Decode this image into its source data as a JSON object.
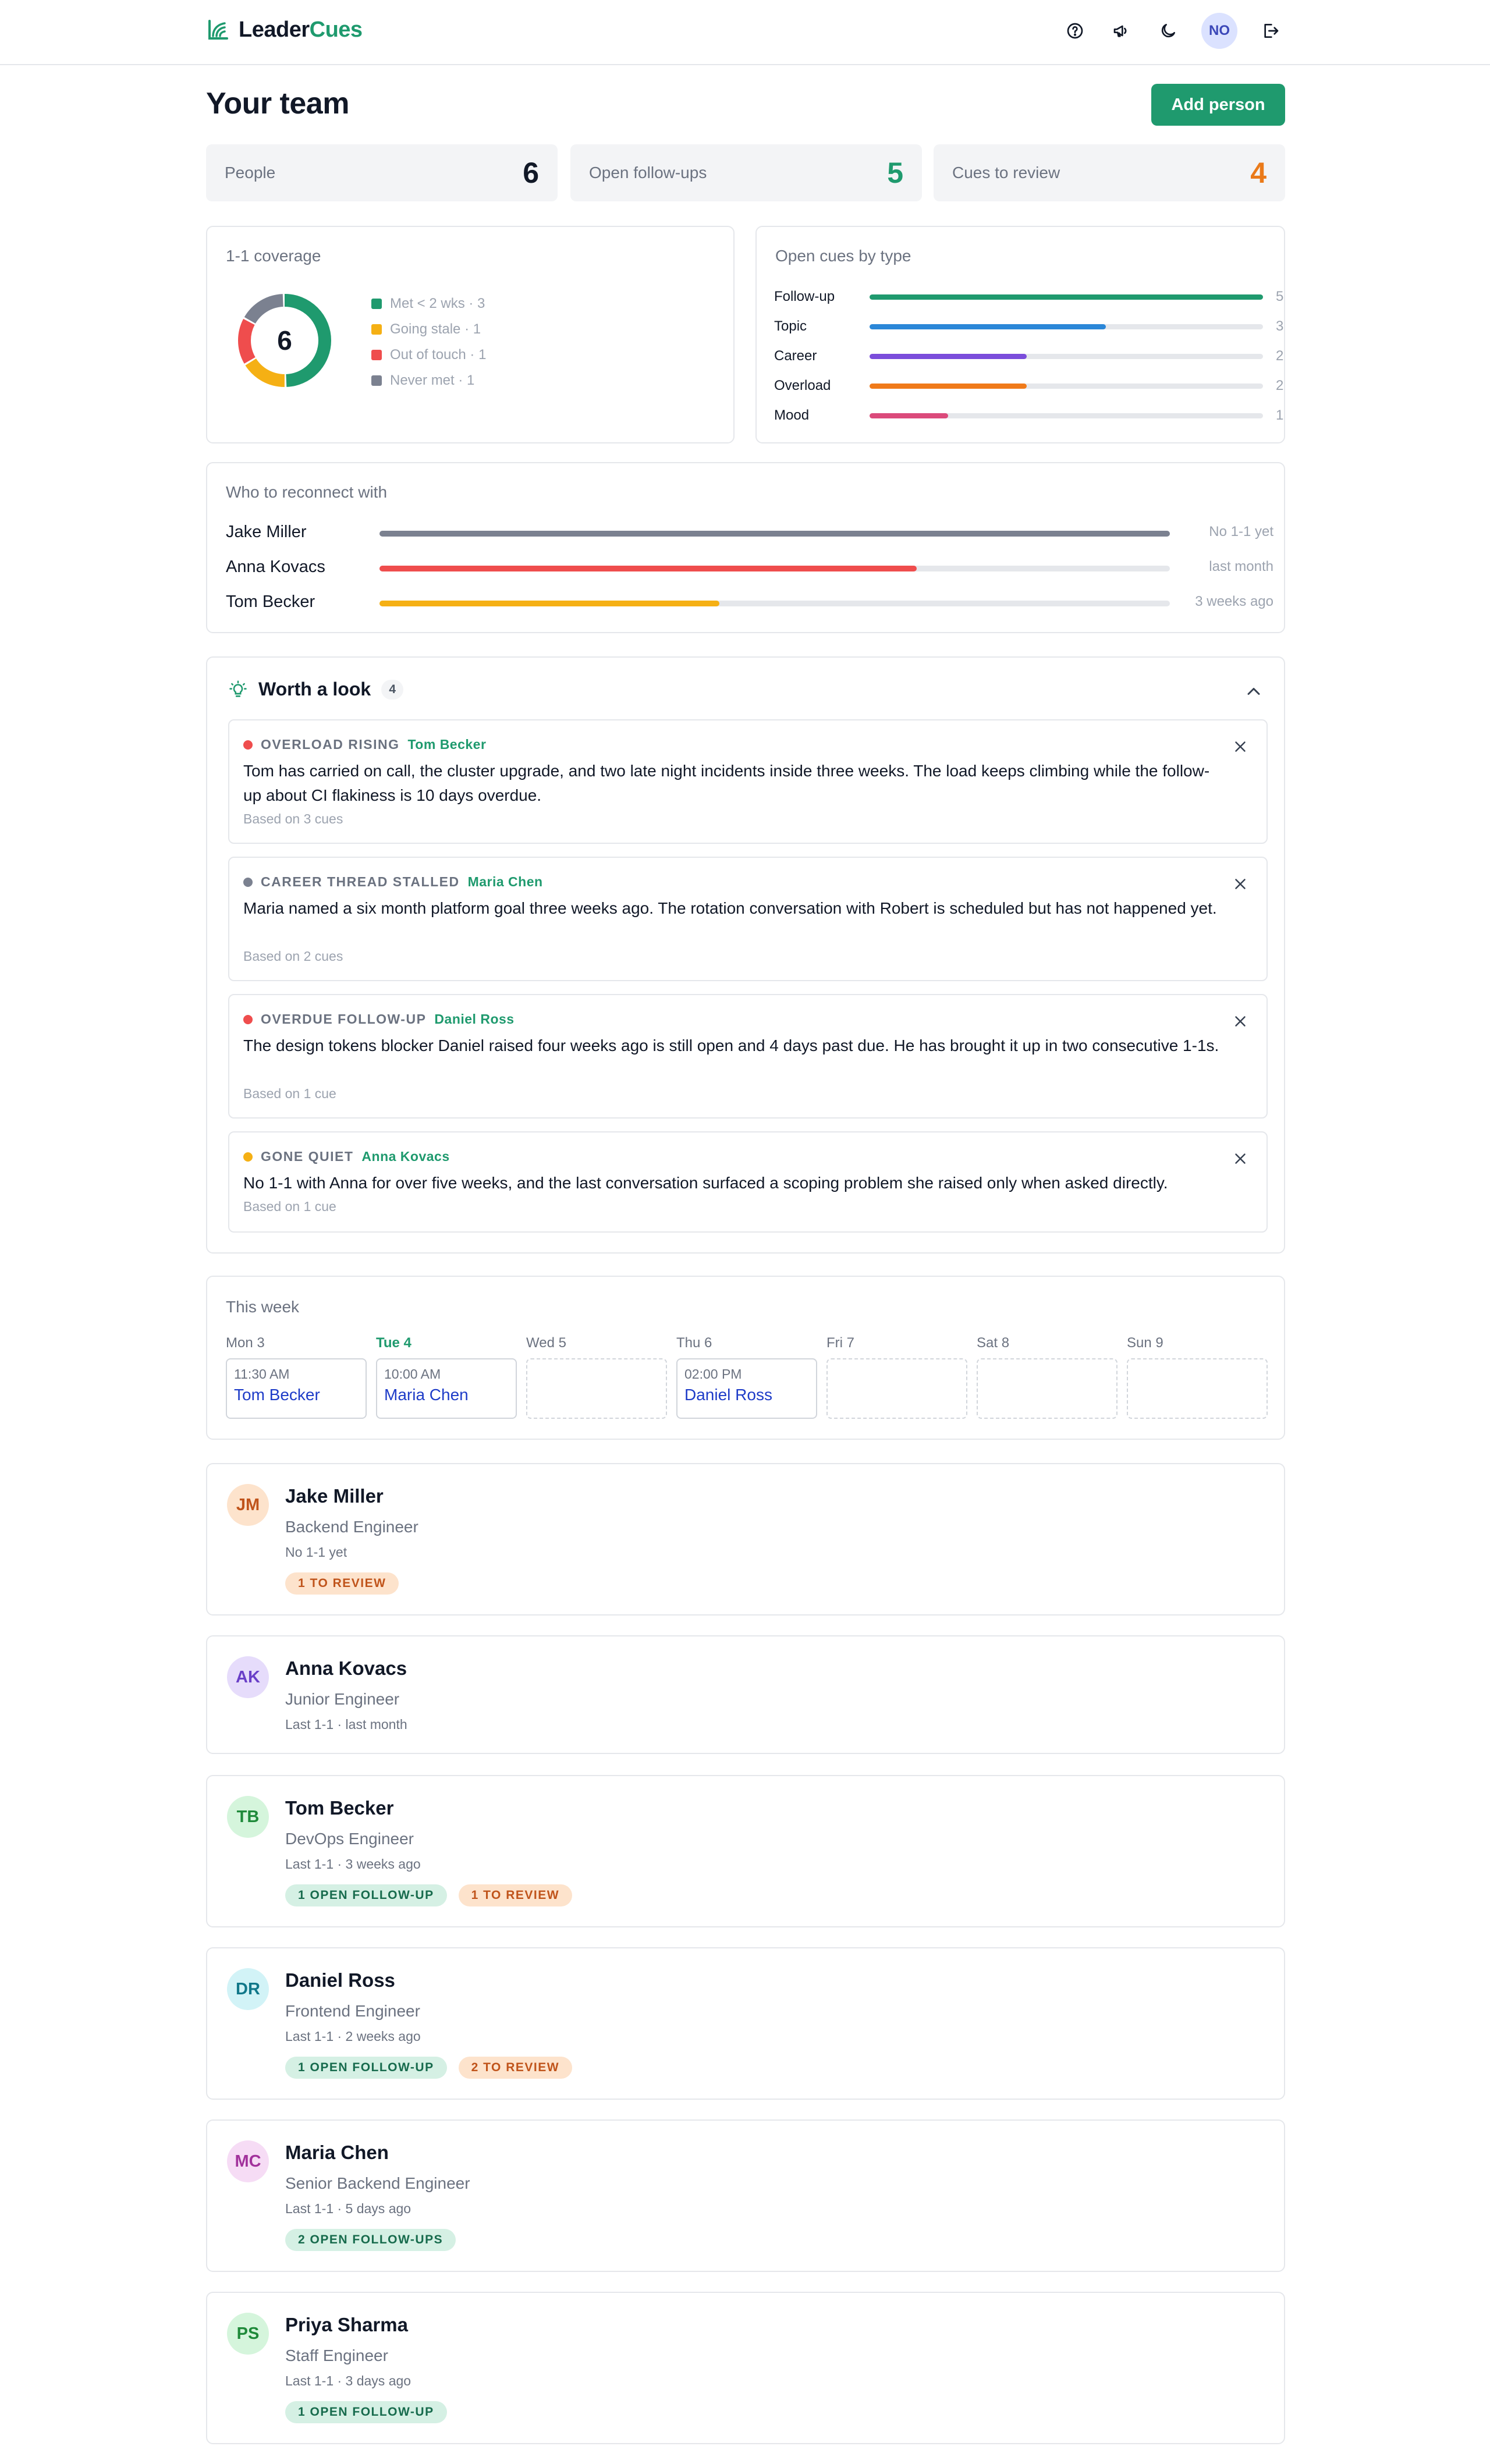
{
  "header": {
    "brand_part1": "Leader",
    "brand_part2": "Cues",
    "avatar_initials": "NO",
    "icons": [
      "help-icon",
      "megaphone-icon",
      "moon-icon",
      "logout-icon"
    ]
  },
  "page": {
    "title": "Your team",
    "add_button": "Add person"
  },
  "stats": [
    {
      "label": "People",
      "value": "6",
      "color": "#111827"
    },
    {
      "label": "Open follow-ups",
      "value": "5",
      "color": "#1f9a6e"
    },
    {
      "label": "Cues to review",
      "value": "4",
      "color": "#ea7a1a"
    }
  ],
  "coverage": {
    "title": "1-1 coverage",
    "total": "6",
    "legend": [
      {
        "label": "Met < 2 wks · 3",
        "count": 3,
        "color": "#1f9a6e"
      },
      {
        "label": "Going stale · 1",
        "count": 1,
        "color": "#f5b014"
      },
      {
        "label": "Out of touch · 1",
        "count": 1,
        "color": "#ef4d4d"
      },
      {
        "label": "Never met · 1",
        "count": 1,
        "color": "#7b8190"
      }
    ]
  },
  "cue_types": {
    "title": "Open cues by type",
    "max": 5,
    "rows": [
      {
        "name": "Follow-up",
        "count": "5",
        "value": 5,
        "color": "#1f9a6e"
      },
      {
        "name": "Topic",
        "count": "3",
        "value": 3,
        "color": "#2b87d8"
      },
      {
        "name": "Career",
        "count": "2",
        "value": 2,
        "color": "#7b4ddb"
      },
      {
        "name": "Overload",
        "count": "2",
        "value": 2,
        "color": "#f07a1a"
      },
      {
        "name": "Mood",
        "count": "1",
        "value": 1,
        "color": "#db4a7b"
      }
    ]
  },
  "reconnect": {
    "title": "Who to reconnect with",
    "rows": [
      {
        "name": "Jake Miller",
        "when": "No 1-1 yet",
        "fraction": 1.0,
        "color": "#7b8190"
      },
      {
        "name": "Anna Kovacs",
        "when": "last month",
        "fraction": 0.68,
        "color": "#ef4d4d"
      },
      {
        "name": "Tom Becker",
        "when": "3 weeks ago",
        "fraction": 0.43,
        "color": "#f5b014"
      }
    ]
  },
  "worth_a_look": {
    "title": "Worth a look",
    "count": "4",
    "items": [
      {
        "tag": "OVERLOAD RISING",
        "person": "Tom Becker",
        "dot": "#ef4d4d",
        "text": "Tom has carried on call, the cluster upgrade, and two late night incidents inside three weeks. The load keeps climbing while the follow-up about CI flakiness is 10 days overdue.",
        "basis": "Based on 3 cues"
      },
      {
        "tag": "CAREER THREAD STALLED",
        "person": "Maria Chen",
        "dot": "#7b8190",
        "text": "Maria named a six month platform goal three weeks ago. The rotation conversation with Robert is scheduled but has not happened yet.",
        "basis": "Based on 2 cues"
      },
      {
        "tag": "OVERDUE FOLLOW-UP",
        "person": "Daniel Ross",
        "dot": "#ef4d4d",
        "text": "The design tokens blocker Daniel raised four weeks ago is still open and 4 days past due. He has brought it up in two consecutive 1-1s.",
        "basis": "Based on 1 cue"
      },
      {
        "tag": "GONE QUIET",
        "person": "Anna Kovacs",
        "dot": "#f5b014",
        "text": "No 1-1 with Anna for over five weeks, and the last conversation surfaced a scoping problem she raised only when asked directly.",
        "basis": "Based on 1 cue"
      }
    ]
  },
  "week": {
    "title": "This week",
    "days": [
      {
        "label": "Mon 3",
        "today": false,
        "time": "11:30 AM",
        "person": "Tom Becker"
      },
      {
        "label": "Tue 4",
        "today": true,
        "time": "10:00 AM",
        "person": "Maria Chen"
      },
      {
        "label": "Wed 5",
        "today": false,
        "time": null,
        "person": null
      },
      {
        "label": "Thu 6",
        "today": false,
        "time": "02:00 PM",
        "person": "Daniel Ross"
      },
      {
        "label": "Fri 7",
        "today": false,
        "time": null,
        "person": null
      },
      {
        "label": "Sat 8",
        "today": false,
        "time": null,
        "person": null
      },
      {
        "label": "Sun 9",
        "today": false,
        "time": null,
        "person": null
      }
    ]
  },
  "people": [
    {
      "initials": "JM",
      "name": "Jake Miller",
      "role": "Backend Engineer",
      "last": "No 1-1 yet",
      "avatar_bg": "#fde3cc",
      "avatar_fg": "#c0541b",
      "badges": [
        {
          "text": "1 TO REVIEW",
          "kind": "rv"
        }
      ]
    },
    {
      "initials": "AK",
      "name": "Anna Kovacs",
      "role": "Junior Engineer",
      "last": "Last 1-1 · last month",
      "avatar_bg": "#e6dcfb",
      "avatar_fg": "#6a3fc8",
      "badges": []
    },
    {
      "initials": "TB",
      "name": "Tom Becker",
      "role": "DevOps Engineer",
      "last": "Last 1-1 · 3 weeks ago",
      "avatar_bg": "#d5f5dc",
      "avatar_fg": "#1f8a3a",
      "badges": [
        {
          "text": "1 OPEN FOLLOW-UP",
          "kind": "fu"
        },
        {
          "text": "1 TO REVIEW",
          "kind": "rv"
        }
      ]
    },
    {
      "initials": "DR",
      "name": "Daniel Ross",
      "role": "Frontend Engineer",
      "last": "Last 1-1 · 2 weeks ago",
      "avatar_bg": "#d2f3f7",
      "avatar_fg": "#11788a",
      "badges": [
        {
          "text": "1 OPEN FOLLOW-UP",
          "kind": "fu"
        },
        {
          "text": "2 TO REVIEW",
          "kind": "rv"
        }
      ]
    },
    {
      "initials": "MC",
      "name": "Maria Chen",
      "role": "Senior Backend Engineer",
      "last": "Last 1-1 · 5 days ago",
      "avatar_bg": "#f6dcf5",
      "avatar_fg": "#a2329c",
      "badges": [
        {
          "text": "2 OPEN FOLLOW-UPS",
          "kind": "fu"
        }
      ]
    },
    {
      "initials": "PS",
      "name": "Priya Sharma",
      "role": "Staff Engineer",
      "last": "Last 1-1 · 3 days ago",
      "avatar_bg": "#d5f5dc",
      "avatar_fg": "#1f8a3a",
      "badges": [
        {
          "text": "1 OPEN FOLLOW-UP",
          "kind": "fu"
        }
      ]
    }
  ]
}
